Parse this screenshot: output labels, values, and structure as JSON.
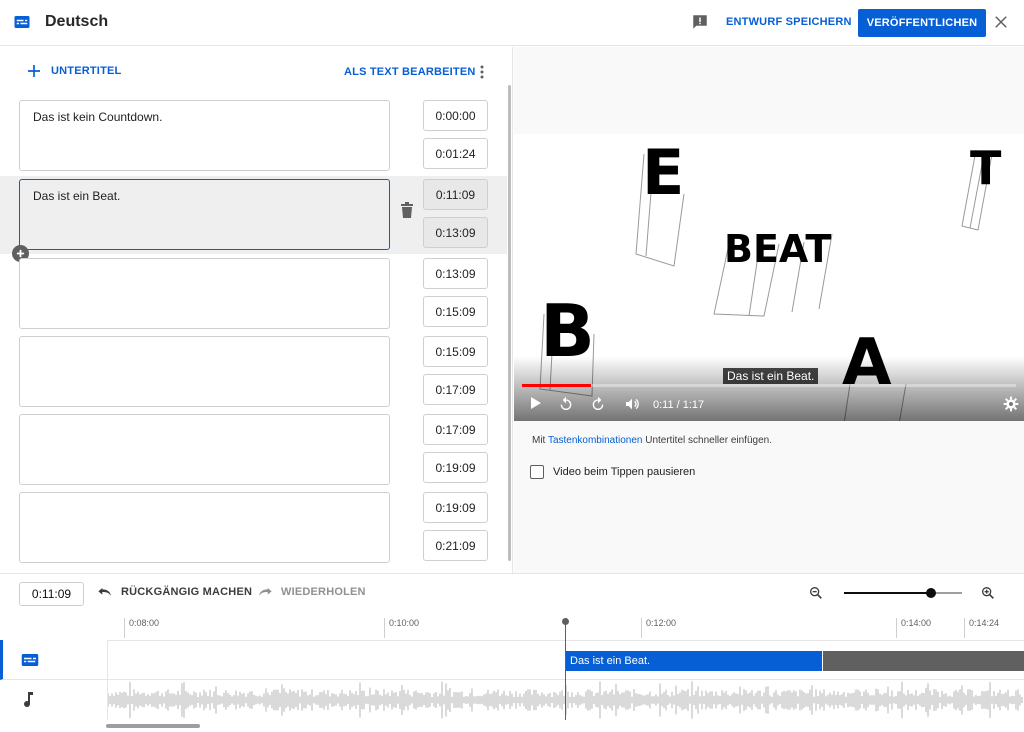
{
  "header": {
    "title": "Deutsch",
    "save_draft": "ENTWURF SPEICHERN",
    "publish": "VERÖFFENTLICHEN",
    "accent": "#065fd4"
  },
  "editor": {
    "add_subtitle": "UNTERTITEL",
    "edit_as_text": "ALS TEXT BEARBEITEN",
    "rows": [
      {
        "text": "Das ist kein Countdown.",
        "start": "0:00:00",
        "end": "0:01:24"
      },
      {
        "text": "Das ist ein Beat.",
        "start": "0:11:09",
        "end": "0:13:09"
      },
      {
        "text": "",
        "start": "0:13:09",
        "end": "0:15:09"
      },
      {
        "text": "",
        "start": "0:15:09",
        "end": "0:17:09"
      },
      {
        "text": "",
        "start": "0:17:09",
        "end": "0:19:09"
      },
      {
        "text": "",
        "start": "0:19:09",
        "end": "0:21:09"
      }
    ]
  },
  "video": {
    "caption": "Das ist ein Beat.",
    "timecode": "0:11 / 1:17",
    "progress": 0.14,
    "hint_prefix": "Mit ",
    "hint_link": "Tastenkombinationen",
    "hint_suffix": " Untertitel schneller einfügen.",
    "pause_label": "Video beim Tippen pausieren",
    "frame_letters": [
      "E",
      "T",
      "BEAT",
      "B",
      "A"
    ]
  },
  "timeline": {
    "current_time": "0:11:09",
    "undo": "RÜCKGÄNGIG MACHEN",
    "redo": "WIEDERHOLEN",
    "ticks": [
      "0:08:00",
      "0:10:00",
      "0:12:00",
      "0:14:00",
      "0:14:24"
    ],
    "segment_text": "Das ist ein Beat."
  }
}
